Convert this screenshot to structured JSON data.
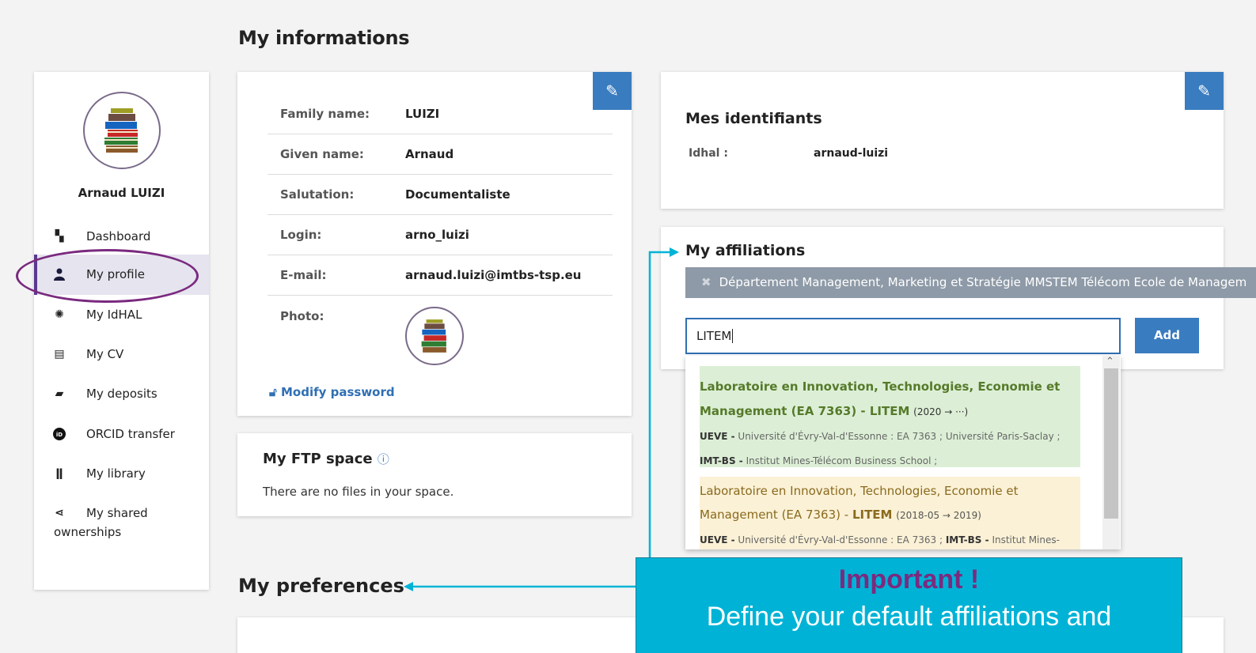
{
  "page": {
    "title": "My informations",
    "preferences_title": "My preferences"
  },
  "sidebar": {
    "user_name": "Arnaud LUIZI",
    "items": [
      {
        "label": "Dashboard",
        "icon": "dashboard-icon"
      },
      {
        "label": "My profile",
        "icon": "user-icon",
        "active": true
      },
      {
        "label": "My IdHAL",
        "icon": "idhal-icon"
      },
      {
        "label": "My CV",
        "icon": "cv-icon"
      },
      {
        "label": "My deposits",
        "icon": "folder-icon"
      },
      {
        "label": "ORCID transfer",
        "icon": "orcid-icon"
      },
      {
        "label": "My library",
        "icon": "library-icon"
      },
      {
        "label_line1": "My shared",
        "label_line2": "ownerships",
        "icon": "share-icon"
      }
    ]
  },
  "info": {
    "rows": [
      {
        "key": "Family name:",
        "value": "LUIZI"
      },
      {
        "key": "Given name:",
        "value": "Arnaud"
      },
      {
        "key": "Salutation:",
        "value": "Documentaliste"
      },
      {
        "key": "Login:",
        "value": "arno_luizi"
      },
      {
        "key": "E-mail:",
        "value": "arnaud.luizi@imtbs-tsp.eu"
      }
    ],
    "photo_label": "Photo:",
    "modify_password": "Modify password"
  },
  "ftp": {
    "title": "My FTP space",
    "info_glyph": "ⓘ",
    "empty_text": "There are no files in your space."
  },
  "identifiers": {
    "title": "Mes identifiants",
    "key": "Idhal :",
    "value": "arnaud-luizi"
  },
  "affiliations": {
    "title": "My affiliations",
    "tag": "Département Management, Marketing et Stratégie MMSTEM Télécom Ecole de Managem",
    "input_value": "LITEM",
    "add_label": "Add",
    "options": [
      {
        "line1": "Laboratoire en Innovation, Technologies, Economie et",
        "line2_main": "Management (EA 7363) - LITEM",
        "line2_dates": "(2020 → ···)",
        "meta1_code": "UEVE -",
        "meta1_text": "Université d'Évry-Val-d'Essonne : EA 7363 ; Université Paris-Saclay ;",
        "meta2_code": "IMT-BS -",
        "meta2_text": "Institut Mines-Télécom Business School ;"
      },
      {
        "line1": "Laboratoire en Innovation, Technologies, Economie et",
        "line2_main": "Management (EA 7363) -",
        "line2_bold": "LITEM",
        "line2_dates": "(2018-05 → 2019)",
        "meta1_code": "UEVE -",
        "meta1_text": "Université d'Évry-Val-d'Essonne : EA 7363 ;",
        "meta1_code2": "IMT-BS -",
        "meta1_text2": "Institut Mines-"
      }
    ]
  },
  "callout": {
    "title": "Important !",
    "line1": "Define your default affiliations and"
  },
  "colors": {
    "accent": "#3a7cc0",
    "highlight": "#7a2a7f",
    "callout_bg": "#00b3d6",
    "arrow": "#00b3d6"
  }
}
